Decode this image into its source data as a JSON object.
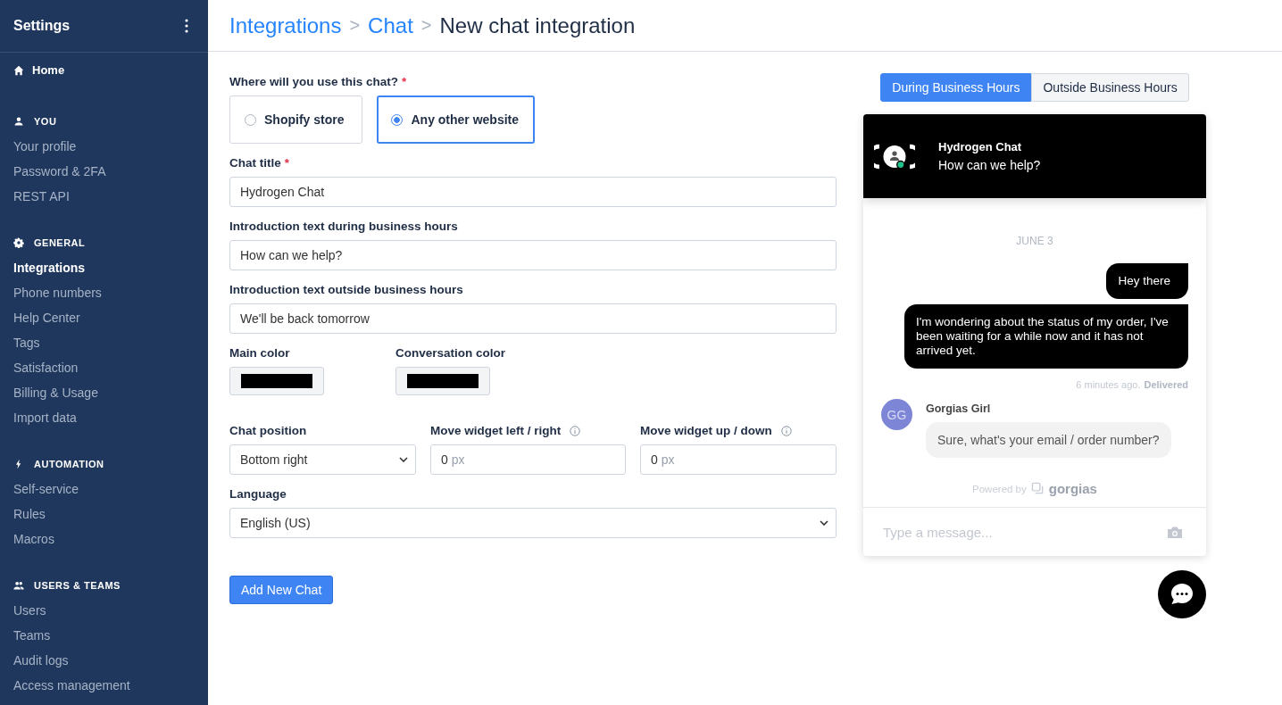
{
  "sidebar": {
    "title": "Settings",
    "home": {
      "label": "Home",
      "selected": false
    },
    "sections": [
      {
        "title": "YOU",
        "items": [
          {
            "label": "Your profile",
            "selected": false
          },
          {
            "label": "Password & 2FA",
            "selected": false
          },
          {
            "label": "REST API",
            "selected": false
          }
        ]
      },
      {
        "title": "GENERAL",
        "items": [
          {
            "label": "Integrations",
            "selected": true
          },
          {
            "label": "Phone numbers",
            "selected": false
          },
          {
            "label": "Help Center",
            "selected": false
          },
          {
            "label": "Tags",
            "selected": false
          },
          {
            "label": "Satisfaction",
            "selected": false
          },
          {
            "label": "Billing & Usage",
            "selected": false
          },
          {
            "label": "Import data",
            "selected": false
          }
        ]
      },
      {
        "title": "AUTOMATION",
        "items": [
          {
            "label": "Self-service",
            "selected": false
          },
          {
            "label": "Rules",
            "selected": false
          },
          {
            "label": "Macros",
            "selected": false
          }
        ]
      },
      {
        "title": "USERS & TEAMS",
        "items": [
          {
            "label": "Users",
            "selected": false
          },
          {
            "label": "Teams",
            "selected": false
          },
          {
            "label": "Audit logs",
            "selected": false
          },
          {
            "label": "Access management",
            "selected": false
          }
        ]
      }
    ]
  },
  "breadcrumb": [
    {
      "kind": "link",
      "text": "Integrations"
    },
    {
      "kind": "separator",
      "text": ">"
    },
    {
      "kind": "link",
      "text": "Chat"
    },
    {
      "kind": "separator",
      "text": ">"
    },
    {
      "kind": "current",
      "text": "New chat integration"
    }
  ],
  "form": {
    "usage": {
      "label": "Where will you use this chat?",
      "required_mark": "*",
      "options": [
        {
          "label": "Shopify store",
          "selected": false
        },
        {
          "label": "Any other website",
          "selected": true
        }
      ]
    },
    "text_fields": [
      {
        "label": "Chat title",
        "required_mark": "*",
        "value": "Hydrogen Chat"
      },
      {
        "label": "Introduction text during business hours",
        "value": "How can we help?"
      },
      {
        "label": "Introduction text outside business hours",
        "value": "We'll be back tomorrow"
      }
    ],
    "colors": [
      {
        "label": "Main color",
        "color": "#000000"
      },
      {
        "label": "Conversation color",
        "color": "#000000"
      }
    ],
    "position": {
      "label": "Chat position",
      "value": "Bottom right"
    },
    "offsets": [
      {
        "label": "Move widget left / right",
        "value": "0",
        "unit": "px"
      },
      {
        "label": "Move widget up / down",
        "value": "0",
        "unit": "px"
      }
    ],
    "language": {
      "label": "Language",
      "value": "English (US)"
    },
    "submit": "Add New Chat"
  },
  "preview": {
    "tabs": [
      {
        "label": "During Business Hours",
        "selected": true
      },
      {
        "label": "Outside Business Hours",
        "selected": false
      }
    ],
    "header": {
      "title": "Hydrogen Chat",
      "subtitle": "How can we help?",
      "online": true
    },
    "date": "JUNE 3",
    "customer_messages": [
      "Hey there",
      "I'm wondering about the status of my order, I've been waiting for a while now and it has not arrived yet."
    ],
    "meta": {
      "time": "6 minutes ago.",
      "status": "Delivered"
    },
    "agent": {
      "initials": "GG",
      "name": "Gorgias Girl",
      "text": "Sure, what's your email / order number?"
    },
    "powered_by": "Powered by",
    "brand": "gorgias",
    "input": {
      "placeholder": "Type a message..."
    }
  }
}
